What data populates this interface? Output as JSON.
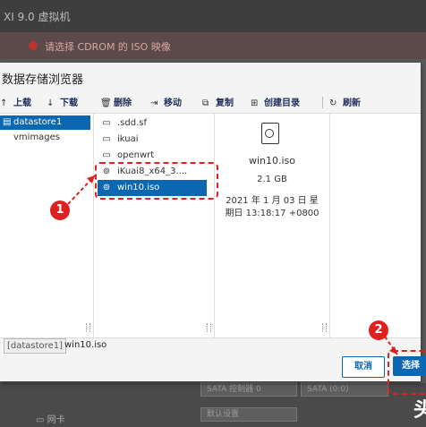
{
  "background": {
    "header_title": "XI 9.0 虚拟机",
    "warning_text": "请选择 CDROM 的 ISO 映像",
    "select1": "SATA 控制器 0",
    "select2": "SATA (0:0)",
    "select3": "默认设置",
    "nic_label": "网卡",
    "watermark": "头"
  },
  "dialog": {
    "title": "数据存储浏览器",
    "toolbar": [
      {
        "label": "上载",
        "icon": "upload-icon"
      },
      {
        "label": "下载",
        "icon": "download-icon"
      },
      {
        "label": "删除",
        "icon": "trash-icon"
      },
      {
        "label": "移动",
        "icon": "move-icon"
      },
      {
        "label": "复制",
        "icon": "copy-icon"
      },
      {
        "label": "创建目录",
        "icon": "new-folder-icon"
      },
      {
        "label": "刷新",
        "icon": "refresh-icon"
      }
    ],
    "datastores": [
      {
        "name": "datastore1",
        "selected": true
      },
      {
        "name": "vmimages",
        "selected": false
      }
    ],
    "files": [
      {
        "name": ".sdd.sf",
        "type": "folder",
        "selected": false
      },
      {
        "name": "ikuai",
        "type": "folder",
        "selected": false
      },
      {
        "name": "openwrt",
        "type": "folder",
        "selected": false
      },
      {
        "name": "iKuai8_x64_3....",
        "type": "disc",
        "selected": false
      },
      {
        "name": "win10.iso",
        "type": "disc",
        "selected": true
      }
    ],
    "preview": {
      "icon": "disc-file-icon",
      "name": "win10.iso",
      "size": "2.1 GB",
      "date_line1": "2021 年 1 月 03 日 星",
      "date_line2": "期日 13:18:17 +0800"
    },
    "path": {
      "datastore": "[datastore1]",
      "file": "win10.iso"
    },
    "cancel_label": "取消",
    "select_label": "选择"
  },
  "annotations": {
    "badge1": "1",
    "badge2": "2",
    "color": "#e02020"
  },
  "colors": {
    "accent": "#0b67b0"
  }
}
